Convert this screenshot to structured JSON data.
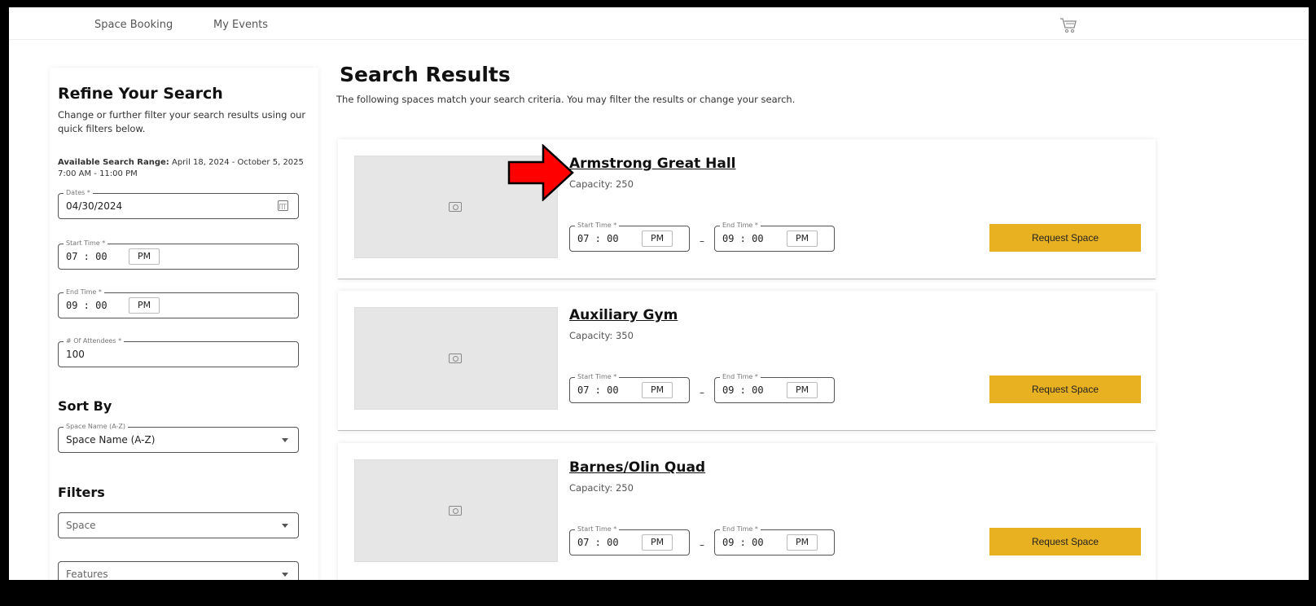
{
  "nav": {
    "items": [
      "Space Booking",
      "My Events"
    ]
  },
  "sidebar": {
    "title": "Refine Your Search",
    "description": "Change or further filter your search results using our quick filters below.",
    "range_label": "Available Search Range:",
    "range_value": " April 18, 2024 - October 5, 2025 7:00 AM - 11:00 PM",
    "dates": {
      "label": "Dates *",
      "value": "04/30/2024"
    },
    "start_time": {
      "label": "Start Time *",
      "value": "07 : 00",
      "ampm": "PM"
    },
    "end_time": {
      "label": "End Time *",
      "value": "09 : 00",
      "ampm": "PM"
    },
    "attendees": {
      "label": "# Of Attendees *",
      "value": "100"
    },
    "sort_by": {
      "heading": "Sort By",
      "label": "Space Name (A-Z)",
      "value": "Space Name (A-Z)"
    },
    "filters": {
      "heading": "Filters",
      "space": "Space",
      "features": "Features"
    }
  },
  "main": {
    "title": "Search Results",
    "description": "The following spaces match your search criteria. You may filter the results or change your search.",
    "results": [
      {
        "name": "Armstrong Great Hall",
        "capacity": "Capacity: 250",
        "start_label": "Start Time *",
        "start_value": "07 : 00",
        "start_ampm": "PM",
        "end_label": "End Time *",
        "end_value": "09 : 00",
        "end_ampm": "PM",
        "dash": "–",
        "button": "Request Space"
      },
      {
        "name": "Auxiliary Gym",
        "capacity": "Capacity: 350",
        "start_label": "Start Time *",
        "start_value": "07 : 00",
        "start_ampm": "PM",
        "end_label": "End Time *",
        "end_value": "09 : 00",
        "end_ampm": "PM",
        "dash": "–",
        "button": "Request Space"
      },
      {
        "name": "Barnes/Olin Quad",
        "capacity": "Capacity: 250",
        "start_label": "Start Time *",
        "start_value": "07 : 00",
        "start_ampm": "PM",
        "end_label": "End Time *",
        "end_value": "09 : 00",
        "end_ampm": "PM",
        "dash": "–",
        "button": "Request Space"
      }
    ]
  },
  "colors": {
    "accent": "#e8b122",
    "annotation_arrow": "#ff0000"
  },
  "icons": {
    "cart": "cart-icon",
    "calendar": "calendar-icon",
    "camera": "camera-icon",
    "dropdown": "chevron-down-icon"
  }
}
